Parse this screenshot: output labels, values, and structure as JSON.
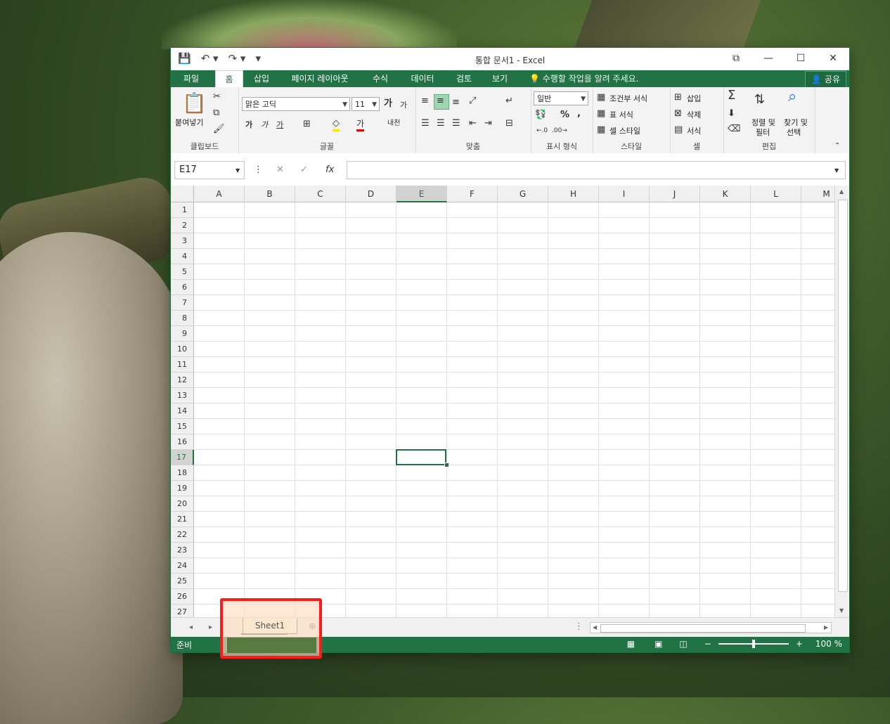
{
  "window": {
    "title": "통합 문서1 - Excel",
    "controls": [
      "⧉",
      "—",
      "☐",
      "✕"
    ]
  },
  "qat": {
    "save": "💾",
    "undo": "↶ ▾",
    "redo": "↷ ▾",
    "customize": "▾"
  },
  "tabs": {
    "file": "파일",
    "home": "홈",
    "insert": "삽입",
    "layout": "페이지 레이아웃",
    "formulas": "수식",
    "data": "데이터",
    "review": "검토",
    "view": "보기",
    "tellme": "💡 수행할 작업을 알려 주세요.",
    "share": "👤 공유"
  },
  "ribbon": {
    "clipboard": {
      "label": "클립보드",
      "paste": "붙여넣기"
    },
    "font": {
      "label": "글꼴",
      "name": "맑은 고딕",
      "size": "11",
      "bold": "가",
      "italic": "가",
      "underline": "가",
      "grow": "가",
      "shrink": "가",
      "phonetic": "내천"
    },
    "alignment": {
      "label": "맞춤"
    },
    "number": {
      "label": "표시 형식",
      "format": "일반",
      "percent": "%",
      "comma": ","
    },
    "styles": {
      "label": "스타일",
      "conditional": "조건부 서식",
      "table": "표 서식",
      "cell": "셀 스타일"
    },
    "cells": {
      "label": "셀",
      "insert": "삽입",
      "delete": "삭제",
      "format": "서식"
    },
    "editing": {
      "label": "편집",
      "sort1": "정렬 및",
      "sort2": "필터",
      "find1": "찾기 및",
      "find2": "선택"
    }
  },
  "formula_bar": {
    "namebox": "E17",
    "cancel": "✕",
    "enter": "✓",
    "fx": "fx",
    "value": ""
  },
  "columns": [
    "A",
    "B",
    "C",
    "D",
    "E",
    "F",
    "G",
    "H",
    "I",
    "J",
    "K",
    "L",
    "M"
  ],
  "selected_column": "E",
  "rows": [
    "1",
    "2",
    "3",
    "4",
    "5",
    "6",
    "7",
    "8",
    "9",
    "10",
    "11",
    "12",
    "13",
    "14",
    "15",
    "16",
    "17",
    "18",
    "19",
    "20",
    "21",
    "22",
    "23",
    "24",
    "25",
    "26",
    "27"
  ],
  "selected_row": "17",
  "sheet": {
    "name": "Sheet1"
  },
  "status": {
    "ready": "준비",
    "zoom": "100 %"
  }
}
